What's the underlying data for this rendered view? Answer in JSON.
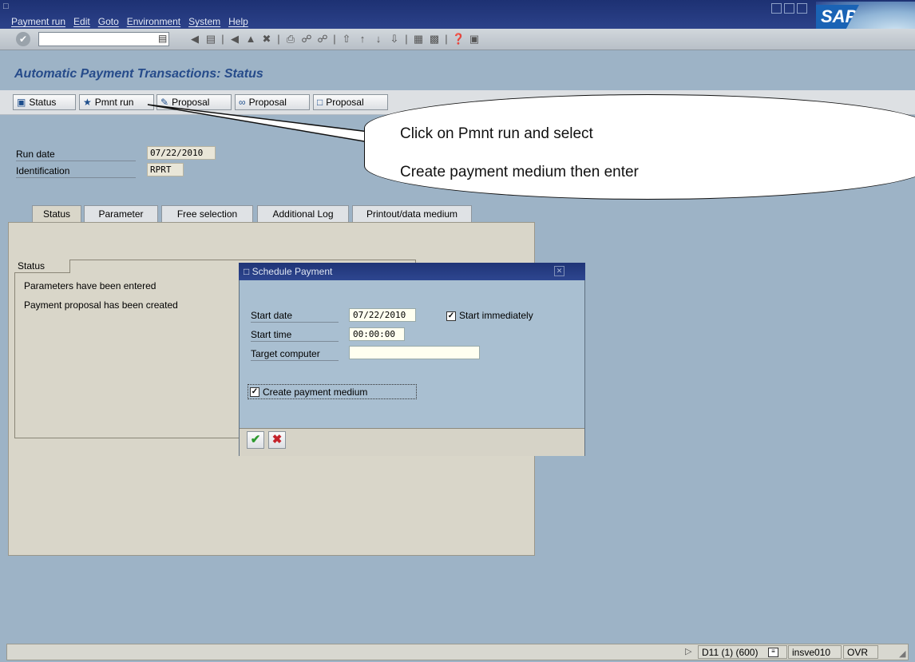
{
  "menu": [
    "Payment run",
    "Edit",
    "Goto",
    "Environment",
    "System",
    "Help"
  ],
  "page_title": "Automatic Payment Transactions: Status",
  "app_toolbar": [
    "Status",
    "Pmnt run",
    "Proposal",
    "Proposal",
    "Proposal"
  ],
  "fields": {
    "run_date_label": "Run date",
    "run_date_value": "07/22/2010",
    "identification_label": "Identification",
    "identification_value": "RPRT"
  },
  "tabs": [
    "Status",
    "Parameter",
    "Free selection",
    "Additional Log",
    "Printout/data medium"
  ],
  "status_group": {
    "title": "Status",
    "lines": [
      "Parameters have been entered",
      "Payment proposal has been created"
    ]
  },
  "dialog": {
    "title": "Schedule Payment",
    "start_date_label": "Start date",
    "start_date_value": "07/22/2010",
    "start_immediately_label": "Start immediately",
    "start_immediately_checked": true,
    "start_time_label": "Start time",
    "start_time_value": "00:00:00",
    "target_computer_label": "Target computer",
    "target_computer_value": "",
    "create_medium_label": "Create payment medium",
    "create_medium_checked": true
  },
  "callout": {
    "line1": "Click on Pmnt run and select",
    "line2": "Create payment medium then enter"
  },
  "statusbar": {
    "system": "D11 (1) (600)",
    "server": "insve010",
    "mode": "OVR"
  },
  "logo_text": "SAP"
}
